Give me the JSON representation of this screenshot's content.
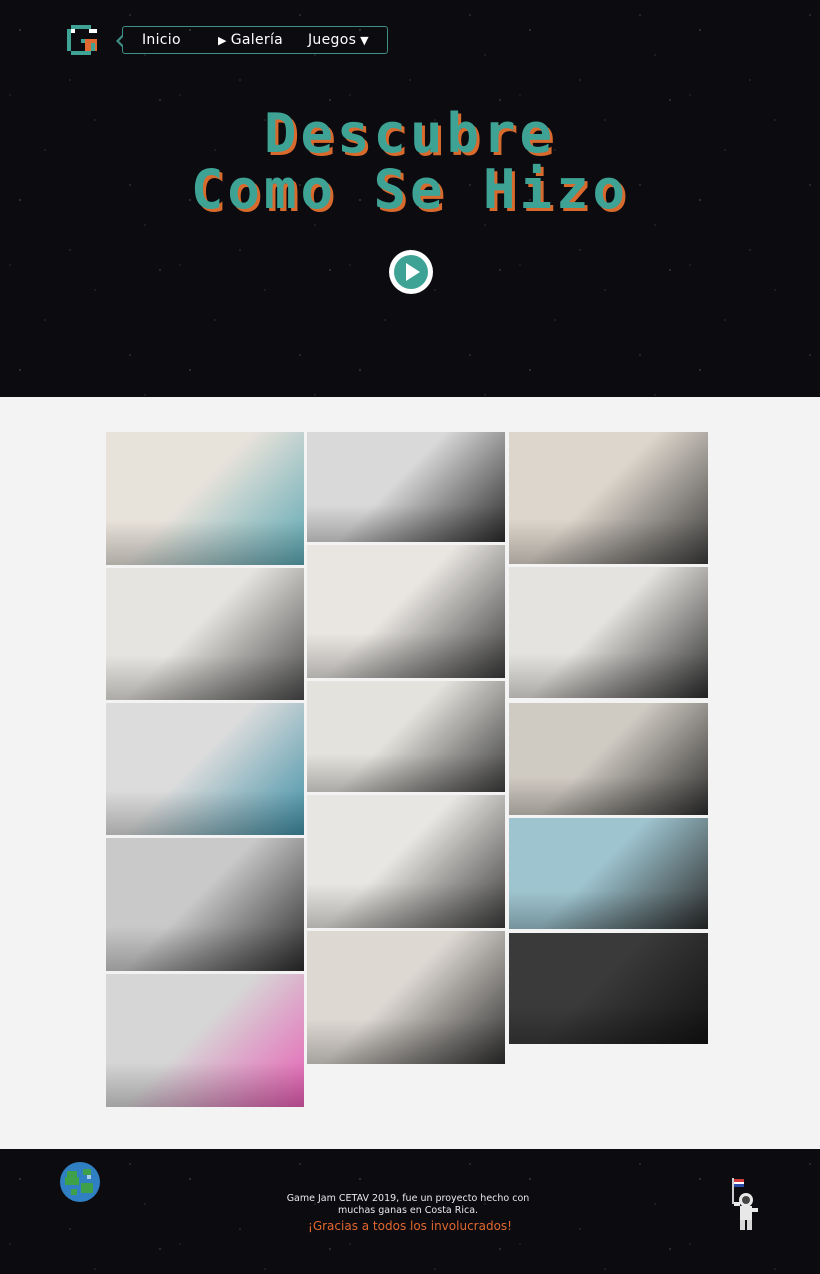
{
  "nav": {
    "items": [
      {
        "label": "Inicio",
        "icon": ""
      },
      {
        "label": "Galería",
        "icon": "play-icon"
      },
      {
        "label": "Juegos",
        "icon": "chevron-down-icon"
      }
    ]
  },
  "hero": {
    "title_line1": "Descubre",
    "title_line2": "Como Se Hizo",
    "play_icon": "play-icon"
  },
  "colors": {
    "accent": "#3ea395",
    "accent_shadow": "#d96a2d",
    "space_bg": "#0c0b10",
    "gallery_bg": "#f3f3f3",
    "thanks": "#e0672e"
  },
  "gallery": {
    "photos": [
      {
        "name": "photo-team-laptop-1",
        "tone": [
          "#e7e2da",
          "#5aa7b3"
        ]
      },
      {
        "name": "photo-computer-lab-1",
        "tone": [
          "#d9d9d9",
          "#2a2a2a"
        ]
      },
      {
        "name": "photo-laptop-meeting",
        "tone": [
          "#ddd6cc",
          "#3b3b3b"
        ]
      },
      {
        "name": "photo-whiteboard-talk-1",
        "tone": [
          "#e6e4e0",
          "#4a4a4a"
        ]
      },
      {
        "name": "photo-computer-lab-2",
        "tone": [
          "#e9e6e2",
          "#3a3a3a"
        ]
      },
      {
        "name": "photo-monitor-work",
        "tone": [
          "#e5e3df",
          "#2c2c2c"
        ]
      },
      {
        "name": "photo-computer-lab-3",
        "tone": [
          "#dcdcdc",
          "#3e8fa6"
        ]
      },
      {
        "name": "photo-whiteboard-sticky",
        "tone": [
          "#e4e2dd",
          "#3c3c3c"
        ]
      },
      {
        "name": "photo-drawing-map",
        "tone": [
          "#cfcac2",
          "#2d2d2d"
        ]
      },
      {
        "name": "photo-presentation-poster",
        "tone": [
          "#e8e6e2",
          "#3a3a3a"
        ]
      },
      {
        "name": "photo-group-stage",
        "tone": [
          "#c9c9c9",
          "#2a2a2a"
        ]
      },
      {
        "name": "photo-projected-map",
        "tone": [
          "#9ec4cf",
          "#2a2a2a"
        ]
      },
      {
        "name": "photo-speaker-gesture",
        "tone": [
          "#ddd8d2",
          "#2e2e2e"
        ]
      },
      {
        "name": "photo-audience-projector",
        "tone": [
          "#3a3a3a",
          "#121212"
        ]
      },
      {
        "name": "photo-sticky-notes-table",
        "tone": [
          "#d6d6d6",
          "#e85cb4"
        ]
      }
    ]
  },
  "footer": {
    "line1": "Game Jam CETAV 2019, fue un proyecto hecho con",
    "line2": "muchas ganas en Costa Rica.",
    "thanks": "¡Gracias a todos los involucrados!",
    "globe_icon": "globe-icon",
    "astronaut_icon": "astronaut-icon"
  }
}
